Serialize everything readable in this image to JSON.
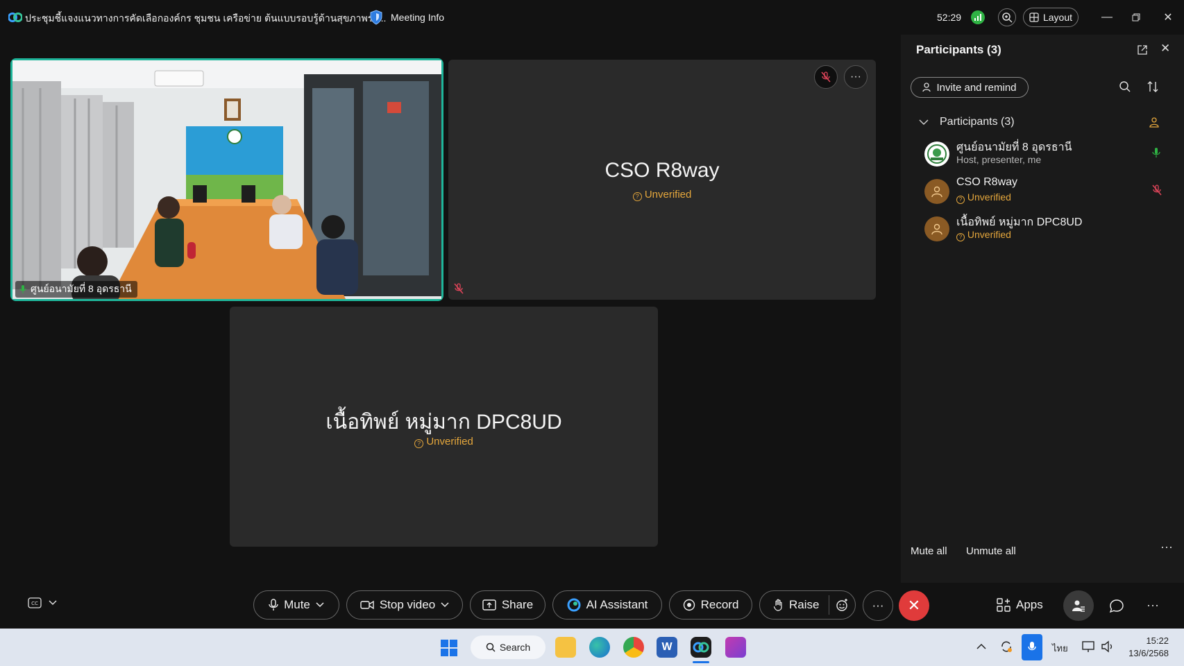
{
  "titlebar": {
    "meeting_title": "ประชุมชี้แจงแนวทางการคัดเลือกองค์กร ชุมชน เครือข่าย ต้นแบบรอบรู้ด้านสุขภาพระ...",
    "meeting_info": "Meeting Info",
    "timer": "52:29",
    "layout_label": "Layout"
  },
  "tiles": {
    "host": {
      "name": "ศูนย์อนามัยที่ 8 อุดรธานี",
      "backdrop_text": "ศูนย์อนามัยที่ 8 อุดรธานี"
    },
    "cso": {
      "name": "CSO R8way",
      "status": "Unverified"
    },
    "dpc": {
      "name": "เนื้อทิพย์ หมู่มาก DPC8UD",
      "status": "Unverified"
    }
  },
  "panel": {
    "title": "Participants (3)",
    "invite_label": "Invite and remind",
    "group_label": "Participants (3)",
    "participants": [
      {
        "name": "ศูนย์อนามัยที่ 8 อุดรธานี",
        "sub": "Host, presenter, me"
      },
      {
        "name": "CSO R8way",
        "sub": "Unverified"
      },
      {
        "name": "เนื้อทิพย์ หมู่มาก DPC8UD",
        "sub": "Unverified"
      }
    ],
    "mute_all": "Mute all",
    "unmute_all": "Unmute all"
  },
  "controls": {
    "mute": "Mute",
    "stop_video": "Stop video",
    "share": "Share",
    "ai_assistant": "AI Assistant",
    "record": "Record",
    "raise": "Raise",
    "apps": "Apps"
  },
  "taskbar": {
    "search": "Search",
    "lang": "ไทย",
    "time": "15:22",
    "date": "13/6/2568"
  },
  "colors": {
    "accent_green": "#1fb59a",
    "warning": "#e5a73c",
    "end_call": "#e03b3b",
    "muted_red": "#e0455a"
  }
}
